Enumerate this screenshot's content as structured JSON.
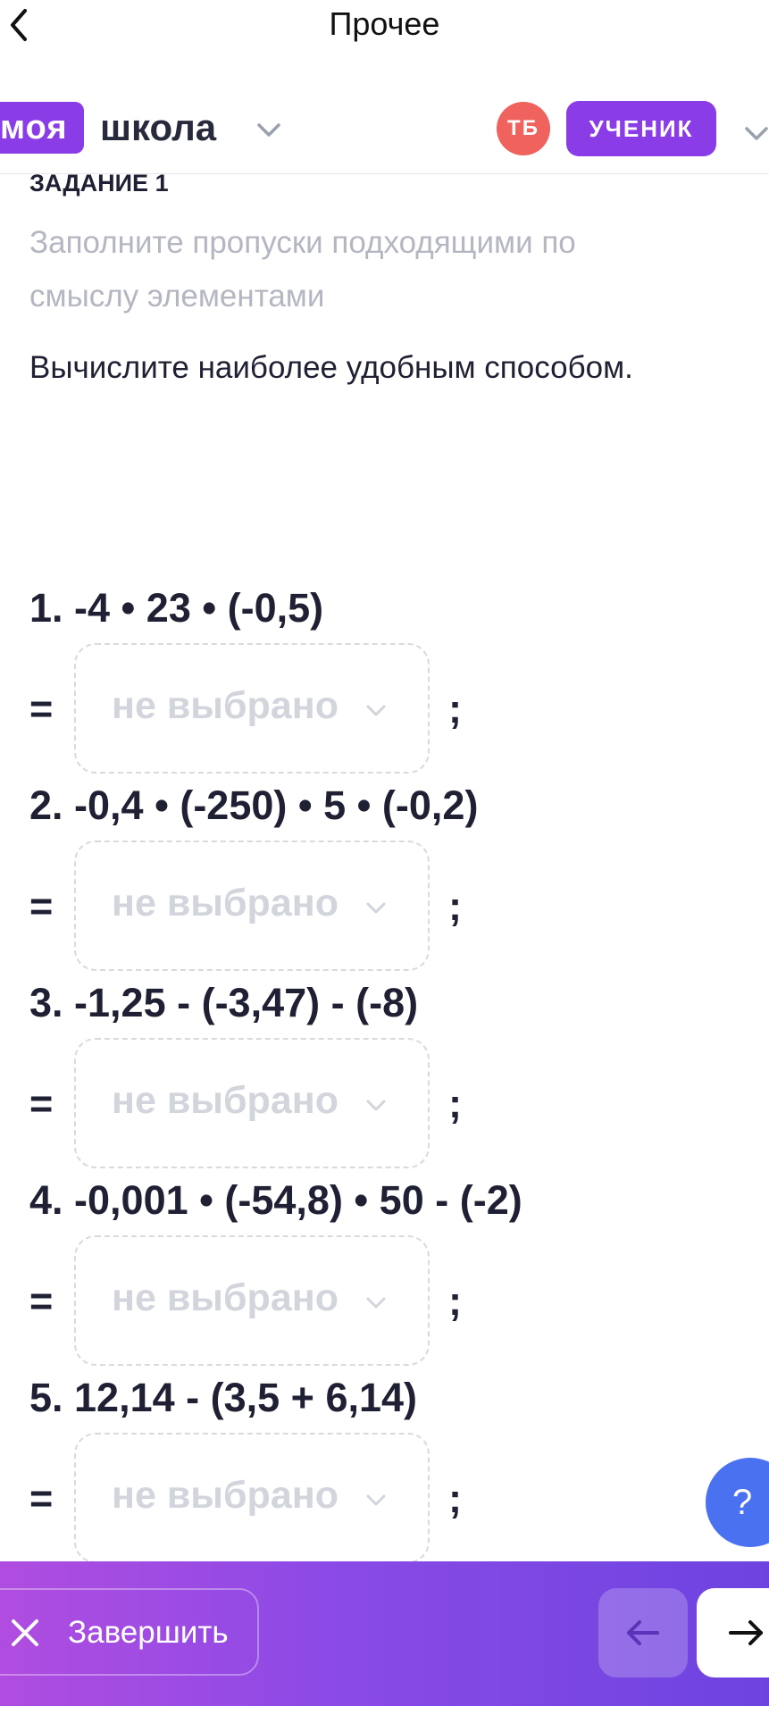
{
  "nav": {
    "title": "Прочее"
  },
  "header": {
    "logo_part1": "моя",
    "logo_part2": "школа",
    "avatar_initials": "ТБ",
    "role": "УЧЕНИК"
  },
  "task": {
    "heading": "ЗАДАНИЕ 1",
    "instruction": "Заполните пропуски подходящими по смыслу элементами",
    "question": "Вычислите наиболее удобным способом.",
    "equals_sign": "=",
    "terminator": ";",
    "items": [
      {
        "expression": "1. -4 • 23 • (-0,5)",
        "selected": "не выбрано"
      },
      {
        "expression": "2. -0,4 • (-250) • 5 • (-0,2)",
        "selected": "не выбрано"
      },
      {
        "expression": "3. -1,25 - (-3,47) - (-8)",
        "selected": "не выбрано"
      },
      {
        "expression": "4. -0,001 • (-54,8) • 50 - (-2)",
        "selected": "не выбрано"
      },
      {
        "expression": "5. 12,14 - (3,5 + 6,14)",
        "selected": "не выбрано"
      }
    ]
  },
  "help": {
    "label": "?"
  },
  "footer": {
    "finish_label": "Завершить"
  },
  "colors": {
    "brand": "#8a3ce6",
    "avatar": "#f0625e",
    "help": "#4a72f0",
    "placeholder": "#d3d5dc"
  }
}
